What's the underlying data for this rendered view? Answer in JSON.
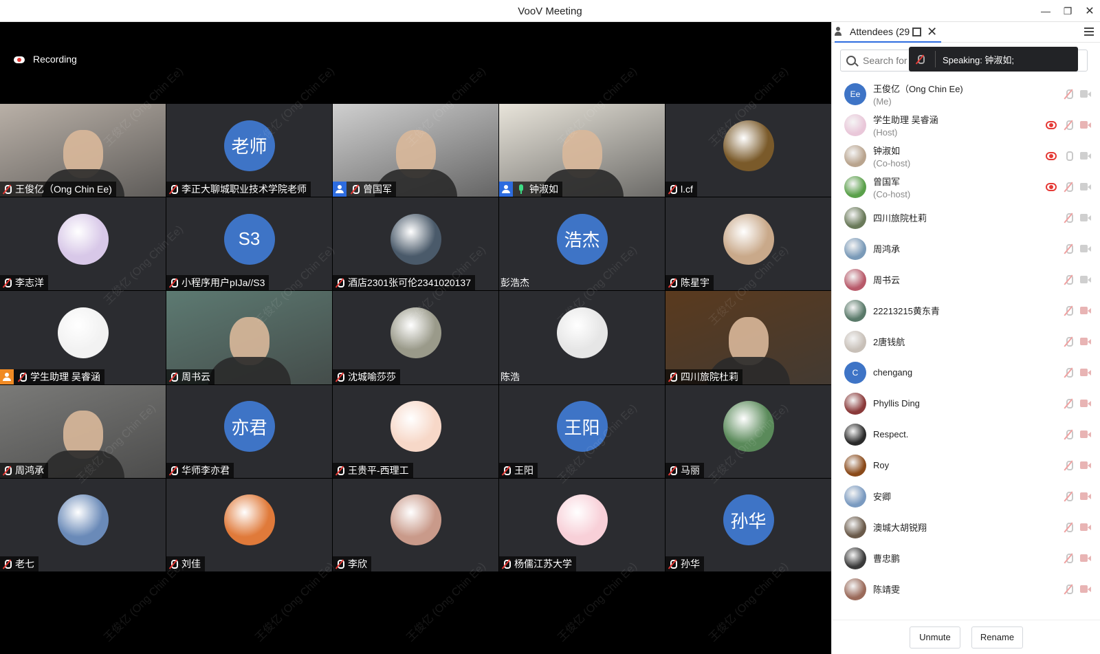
{
  "window": {
    "title": "VooV Meeting"
  },
  "recording_label": "Recording",
  "tiles": [
    {
      "name": "王俊亿（Ong Chin Ee)",
      "type": "video",
      "bg": "#b9b0a7",
      "mic": "muted"
    },
    {
      "name": "李正大聊城职业技术学院老师",
      "type": "text",
      "avatar_text": "老师",
      "mic": "muted"
    },
    {
      "name": "曾国军",
      "type": "video",
      "bg": "#cfcfcf",
      "mic": "muted",
      "badge": "host"
    },
    {
      "name": "钟淑如",
      "type": "video",
      "bg": "#e8e4da",
      "mic": "on",
      "badge": "host",
      "speaking": true
    },
    {
      "name": "l.cf",
      "type": "image",
      "avatar_color": "#7a5a2a",
      "mic": "muted"
    },
    {
      "name": "李志洋",
      "type": "image",
      "avatar_color": "#d8c8e8",
      "mic": "muted"
    },
    {
      "name": "小程序用户pIJa//S3",
      "type": "text",
      "avatar_text": "S3",
      "mic": "muted"
    },
    {
      "name": "酒店2301张可伦2341020137",
      "type": "image",
      "avatar_color": "#4a5a6a",
      "mic": "muted"
    },
    {
      "name": "彭浩杰",
      "type": "text",
      "avatar_text": "浩杰",
      "mic": "none"
    },
    {
      "name": "陈星宇",
      "type": "image",
      "avatar_color": "#c9a98a",
      "mic": "muted"
    },
    {
      "name": "学生助理 吴睿涵",
      "type": "image",
      "avatar_color": "#f2f2f2",
      "mic": "muted",
      "badge": "assistant"
    },
    {
      "name": "周书云",
      "type": "video",
      "bg": "#5d7a72",
      "mic": "muted"
    },
    {
      "name": "沈城喻莎莎",
      "type": "image",
      "avatar_color": "#9a9a8a",
      "mic": "muted"
    },
    {
      "name": "陈浩",
      "type": "image",
      "avatar_color": "#e6e6e6",
      "mic": "none"
    },
    {
      "name": "四川旅院杜莉",
      "type": "video",
      "bg": "#5a3a1e",
      "mic": "muted"
    },
    {
      "name": "周鸿承",
      "type": "video",
      "bg": "#7a7a78",
      "mic": "muted"
    },
    {
      "name": "华师李亦君",
      "type": "text",
      "avatar_text": "亦君",
      "mic": "muted"
    },
    {
      "name": "王贵平-西理工",
      "type": "image",
      "avatar_color": "#f7d8c8",
      "mic": "muted"
    },
    {
      "name": "王阳",
      "type": "text",
      "avatar_text": "王阳",
      "mic": "muted"
    },
    {
      "name": "马丽",
      "type": "image",
      "avatar_color": "#5a8a5a",
      "mic": "muted"
    },
    {
      "name": "老七",
      "type": "image",
      "avatar_color": "#6a8ab8",
      "mic": "muted"
    },
    {
      "name": "刘佳",
      "type": "image",
      "avatar_color": "#e07a3a",
      "mic": "muted"
    },
    {
      "name": "李欣",
      "type": "image",
      "avatar_color": "#c99a8a",
      "mic": "muted"
    },
    {
      "name": "杨儒江苏大学",
      "type": "image",
      "avatar_color": "#f8d0d8",
      "mic": "muted"
    },
    {
      "name": "孙华",
      "type": "text",
      "avatar_text": "孙华",
      "mic": "muted"
    }
  ],
  "watermark": "王俊亿 (Ong Chin Ee)",
  "sidebar": {
    "tab_label": "Attendees (29",
    "search_placeholder": "Search for",
    "speaking_tip": "Speaking: 钟淑如;",
    "attendees": [
      {
        "name": "王俊亿（Ong Chin Ee)",
        "role": "(Me)",
        "avatar_text": "Ee",
        "avatar_color": "#3e74c6",
        "rec": false,
        "cam": "on"
      },
      {
        "name": "学生助理 吴睿涵",
        "role": "(Host)",
        "avatar_text": "",
        "avatar_color": "#e9c7d9",
        "rec": true,
        "cam": "off"
      },
      {
        "name": "钟淑如",
        "role": "(Co-host)",
        "avatar_text": "",
        "avatar_color": "#b9a48e",
        "rec": true,
        "cam": "on",
        "mic": "on"
      },
      {
        "name": "曾国军",
        "role": "(Co-host)",
        "avatar_text": "",
        "avatar_color": "#5aa04a",
        "rec": true,
        "cam": "on"
      },
      {
        "name": "四川旅院杜莉",
        "role": "",
        "avatar_text": "",
        "avatar_color": "#6a7a5a",
        "rec": false,
        "cam": "on"
      },
      {
        "name": "周鸿承",
        "role": "",
        "avatar_text": "",
        "avatar_color": "#7a9ab8",
        "rec": false,
        "cam": "on"
      },
      {
        "name": "周书云",
        "role": "",
        "avatar_text": "",
        "avatar_color": "#b85a6a",
        "rec": false,
        "cam": "on"
      },
      {
        "name": "22213215黄东青",
        "role": "",
        "avatar_text": "",
        "avatar_color": "#5a7a6a",
        "rec": false,
        "cam": "off"
      },
      {
        "name": "2唐钱航",
        "role": "",
        "avatar_text": "",
        "avatar_color": "#c8c0b8",
        "rec": false,
        "cam": "off"
      },
      {
        "name": "chengang",
        "role": "",
        "avatar_text": "C",
        "avatar_color": "#3e74c6",
        "rec": false,
        "cam": "off"
      },
      {
        "name": "Phyllis Ding",
        "role": "",
        "avatar_text": "",
        "avatar_color": "#8a3a3a",
        "rec": false,
        "cam": "off"
      },
      {
        "name": "Respect.",
        "role": "",
        "avatar_text": "",
        "avatar_color": "#2a2a2a",
        "rec": false,
        "cam": "off"
      },
      {
        "name": "Roy",
        "role": "",
        "avatar_text": "",
        "avatar_color": "#8a4a1a",
        "rec": false,
        "cam": "off"
      },
      {
        "name": "安卿",
        "role": "",
        "avatar_text": "",
        "avatar_color": "#7a9ac0",
        "rec": false,
        "cam": "off"
      },
      {
        "name": "澳城大胡锐翔",
        "role": "",
        "avatar_text": "",
        "avatar_color": "#6a5a4a",
        "rec": false,
        "cam": "off"
      },
      {
        "name": "曹忠鹏",
        "role": "",
        "avatar_text": "",
        "avatar_color": "#3a3a3a",
        "rec": false,
        "cam": "off"
      },
      {
        "name": "陈靖雯",
        "role": "",
        "avatar_text": "",
        "avatar_color": "#9a6a5a",
        "rec": false,
        "cam": "off"
      }
    ],
    "unmute_label": "Unmute",
    "rename_label": "Rename"
  }
}
